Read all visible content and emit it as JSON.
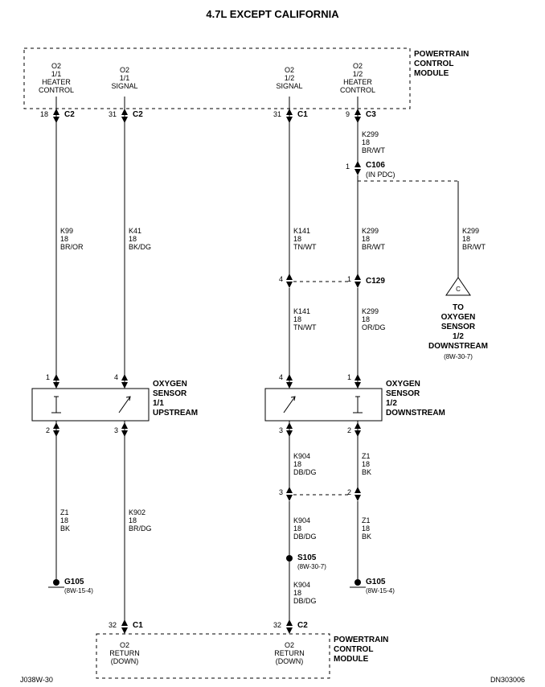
{
  "title": "4.7L EXCEPT CALIFORNIA",
  "footer_left": "J038W-30",
  "footer_right": "DN303006",
  "pcm_top_label": [
    "POWERTRAIN",
    "CONTROL",
    "MODULE"
  ],
  "pcm_bot_label": [
    "POWERTRAIN",
    "CONTROL",
    "MODULE"
  ],
  "col1": {
    "pcm_func": [
      "O2",
      "1/1",
      "HEATER",
      "CONTROL"
    ],
    "pin": "18",
    "conn": "C2",
    "wire_id": "K99",
    "gauge": "18",
    "color": "BR/OR",
    "sensor_pin_top": "1",
    "sensor_pin_bot": "2"
  },
  "col2": {
    "pcm_func": [
      "O2",
      "1/1",
      "SIGNAL"
    ],
    "pin": "31",
    "conn": "C2",
    "wire_id": "K41",
    "gauge": "18",
    "color": "BK/DG",
    "sensor_pin_top": "4",
    "sensor_pin_bot": "3",
    "wire2_id": "K902",
    "wire2_gauge": "18",
    "wire2_color": "BR/DG",
    "bot_pin": "32",
    "bot_conn": "C1",
    "bot_func": [
      "O2",
      "RETURN",
      "(DOWN)"
    ]
  },
  "sensor_left": [
    "OXYGEN",
    "SENSOR",
    "1/1",
    "UPSTREAM"
  ],
  "col3": {
    "pcm_func": [
      "O2",
      "1/2",
      "SIGNAL"
    ],
    "pin": "31",
    "conn": "C1",
    "wire_id": "K141",
    "gauge": "18",
    "color": "TN/WT",
    "c129_pin": "4",
    "wire2_id": "K141",
    "wire2_gauge": "18",
    "wire2_color": "TN/WT",
    "sensor_pin_top": "4",
    "sensor_pin_bot": "3",
    "wire3_id": "K904",
    "wire3_gauge": "18",
    "wire3_color": "DB/DG",
    "splice_pin": "3",
    "wire4_id": "K904",
    "wire4_gauge": "18",
    "wire4_color": "DB/DG",
    "splice": "S105",
    "splice_ref": "(8W-30-7)",
    "wire5_id": "K904",
    "wire5_gauge": "18",
    "wire5_color": "DB/DG",
    "bot_pin": "32",
    "bot_conn": "C2",
    "bot_func": [
      "O2",
      "RETURN",
      "(DOWN)"
    ]
  },
  "col4": {
    "pcm_func": [
      "O2",
      "1/2",
      "HEATER",
      "CONTROL"
    ],
    "pin": "9",
    "conn": "C3",
    "wire1_id": "K299",
    "wire1_gauge": "18",
    "wire1_color": "BR/WT",
    "c106_pin": "1",
    "c106": "C106",
    "c106_note": "(IN PDC)",
    "wire2_id": "K299",
    "wire2_gauge": "18",
    "wire2_color": "BR/WT",
    "c129_pin": "1",
    "c129": "C129",
    "wire3_id": "K299",
    "wire3_gauge": "18",
    "wire3_color": "OR/DG",
    "sensor_pin_top": "1",
    "sensor_pin_bot": "2",
    "wire4_id": "Z1",
    "wire4_gauge": "18",
    "wire4_color": "BK",
    "splice_pin": "2",
    "wire5_id": "Z1",
    "wire5_gauge": "18",
    "wire5_color": "BK"
  },
  "sensor_right": [
    "OXYGEN",
    "SENSOR",
    "1/2",
    "DOWNSTREAM"
  ],
  "col5": {
    "wire_id": "K299",
    "gauge": "18",
    "color": "BR/WT",
    "arrow_label": [
      "TO",
      "OXYGEN",
      "SENSOR",
      "1/2",
      "DOWNSTREAM"
    ],
    "ref": "(8W-30-7)"
  },
  "ground_left": {
    "id": "G105",
    "ref": "(8W-15-4)",
    "wire_id": "Z1",
    "gauge": "18",
    "color": "BK"
  },
  "ground_right": {
    "id": "G105",
    "ref": "(8W-15-4)"
  },
  "arrow_c": "C"
}
